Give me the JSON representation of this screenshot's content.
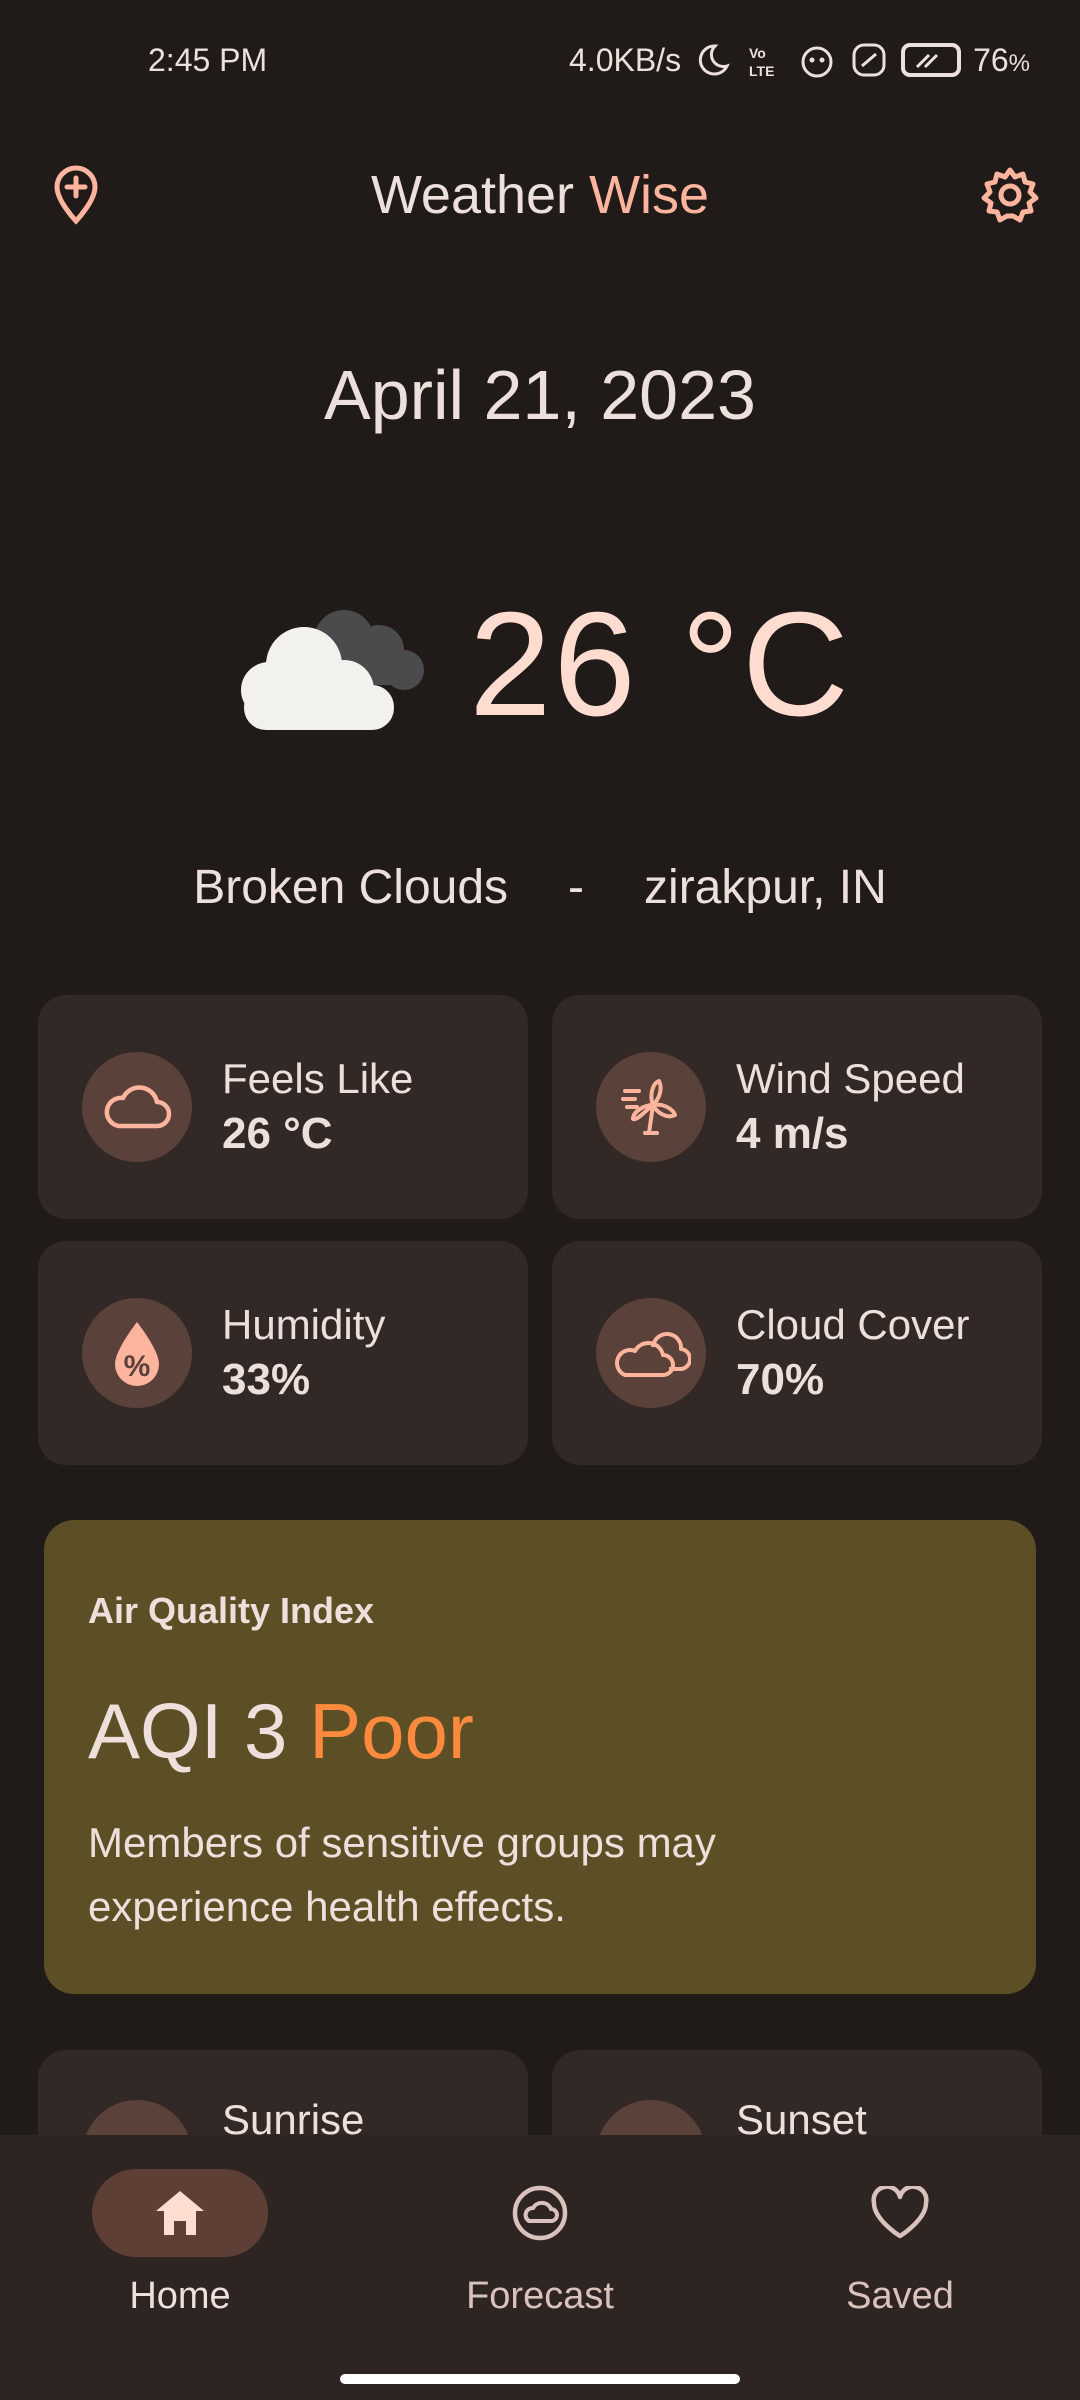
{
  "status_bar": {
    "time": "2:45 PM",
    "network_speed": "4.0KB/s",
    "battery_percent": "76",
    "battery_unit": "%"
  },
  "app_bar": {
    "title_part1": "Weather",
    "title_part2": "Wise",
    "left_icon": "add-location-icon",
    "right_icon": "gear-icon"
  },
  "current": {
    "date": "April 21, 2023",
    "temperature": "26 °C",
    "condition": "Broken Clouds",
    "separator": "-",
    "location": "zirakpur, IN",
    "weather_icon": "broken-clouds-icon"
  },
  "details": [
    {
      "label": "Feels Like",
      "value": "26 °C",
      "icon": "cloud-icon"
    },
    {
      "label": "Wind Speed",
      "value": "4 m/s",
      "icon": "wind-turbine-icon"
    },
    {
      "label": "Humidity",
      "value": "33%",
      "icon": "humidity-drop-icon"
    },
    {
      "label": "Cloud Cover",
      "value": "70%",
      "icon": "clouds-icon"
    }
  ],
  "aqi": {
    "title": "Air Quality Index",
    "value": "AQI 3",
    "status": "Poor",
    "description": "Members of sensitive groups may experience health effects."
  },
  "sun": {
    "sunrise_label": "Sunrise",
    "sunset_label": "Sunset"
  },
  "nav": [
    {
      "label": "Home",
      "icon": "home-icon",
      "active": true
    },
    {
      "label": "Forecast",
      "icon": "forecast-icon",
      "active": false
    },
    {
      "label": "Saved",
      "icon": "heart-icon",
      "active": false
    }
  ],
  "colors": {
    "background": "#201a18",
    "accent": "#ffb59d",
    "tile": "#322826",
    "aqi_card": "#5c4f25",
    "aqi_status": "#ff8a3d"
  }
}
